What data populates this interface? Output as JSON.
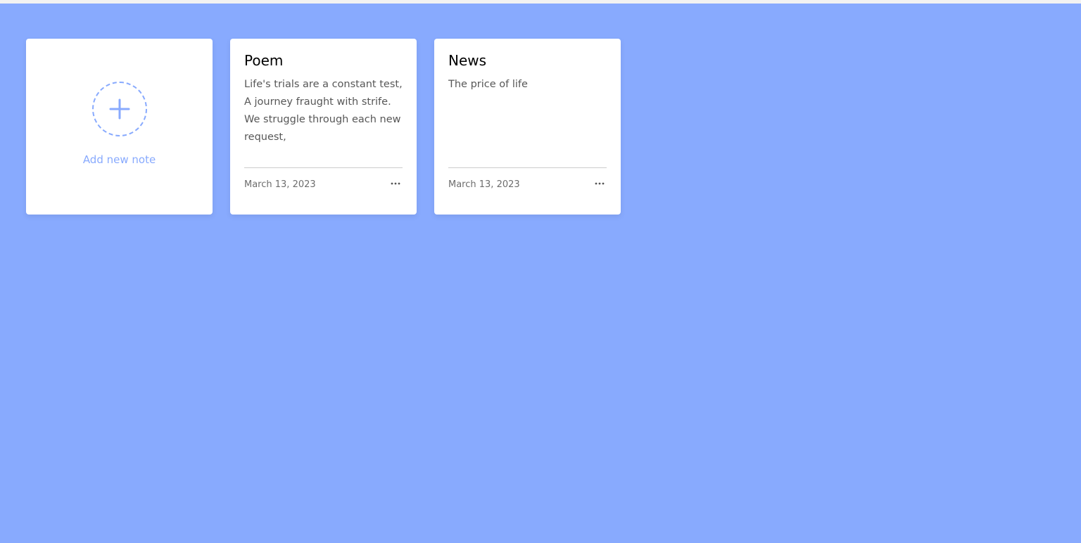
{
  "colors": {
    "background": "#88aafe",
    "accent": "#88aafe",
    "card": "#ffffff"
  },
  "add_card": {
    "icon": "plus-icon",
    "label": "Add new note"
  },
  "notes": [
    {
      "title": "Poem",
      "lines": [
        "Life's trials are a constant test,",
        "A journey fraught with strife.",
        "We struggle through each new request,"
      ],
      "date": "March 13, 2023",
      "menu_icon": "more-horizontal-icon"
    },
    {
      "title": "News",
      "lines": [
        "The price of life"
      ],
      "date": "March 13, 2023",
      "menu_icon": "more-horizontal-icon"
    }
  ]
}
